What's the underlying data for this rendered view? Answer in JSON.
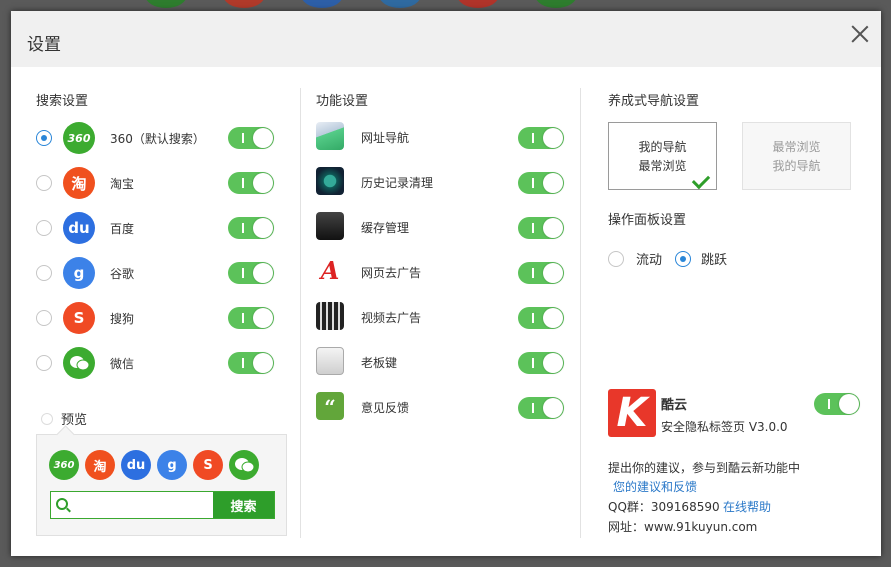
{
  "dialog": {
    "title": "设置"
  },
  "search_settings": {
    "title": "搜索设置",
    "engines": [
      {
        "label": "360（默认搜索）",
        "icon": "360-search-icon",
        "glyph": "360",
        "color": "#3cab30",
        "selected": true,
        "enabled": true
      },
      {
        "label": "淘宝",
        "icon": "taobao-icon",
        "glyph": "淘",
        "color": "#f0501e",
        "selected": false,
        "enabled": true
      },
      {
        "label": "百度",
        "icon": "baidu-icon",
        "glyph": "du",
        "color": "#2d6fe0",
        "selected": false,
        "enabled": true
      },
      {
        "label": "谷歌",
        "icon": "google-icon",
        "glyph": "g",
        "color": "#3c82e8",
        "selected": false,
        "enabled": true
      },
      {
        "label": "搜狗",
        "icon": "sogou-icon",
        "glyph": "S",
        "color": "#f04a24",
        "selected": false,
        "enabled": true
      },
      {
        "label": "微信",
        "icon": "wechat-icon",
        "glyph": "",
        "color": "#3cab30",
        "selected": false,
        "enabled": true
      }
    ],
    "preview_label": "预览",
    "search_button": "搜索",
    "search_value": ""
  },
  "function_settings": {
    "title": "功能设置",
    "items": [
      {
        "label": "网址导航",
        "icon": "url-navigation-icon",
        "enabled": true
      },
      {
        "label": "历史记录清理",
        "icon": "history-clock-icon",
        "enabled": true
      },
      {
        "label": "缓存管理",
        "icon": "cache-management-icon",
        "enabled": true
      },
      {
        "label": "网页去广告",
        "icon": "webpage-adblock-icon",
        "enabled": true
      },
      {
        "label": "视频去广告",
        "icon": "video-adblock-icon",
        "enabled": true
      },
      {
        "label": "老板键",
        "icon": "boss-key-icon",
        "enabled": true
      },
      {
        "label": "意见反馈",
        "icon": "feedback-quote-icon",
        "enabled": true
      }
    ]
  },
  "nav_settings": {
    "title": "养成式导航设置",
    "option_a": {
      "line1": "我的导航",
      "line2": "最常浏览",
      "selected": true
    },
    "option_b": {
      "line1": "最常浏览",
      "line2": "我的导航",
      "selected": false
    }
  },
  "panel_settings": {
    "title": "操作面板设置",
    "options": [
      {
        "label": "流动",
        "selected": false
      },
      {
        "label": "跳跃",
        "selected": true
      }
    ]
  },
  "about": {
    "app_name": "酷云",
    "logo_letter": "K",
    "description": "安全隐私标签页 V3.0.0",
    "enabled": true,
    "suggestion_text": "提出你的建议，参与到酷云新功能中",
    "feedback_link": "您的建议和反馈",
    "qq_group": "QQ群：309168590",
    "online_help": "在线帮助",
    "website": "网址：www.91kuyun.com"
  },
  "colors": {
    "toggle_on": "#5cc25a",
    "accent_green": "#2e9e2a",
    "link_blue": "#2a78c8",
    "radio_blue": "#2a86d8"
  }
}
